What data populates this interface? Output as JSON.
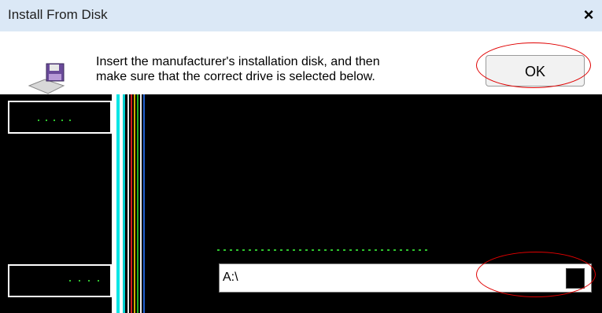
{
  "window": {
    "title": "Install From Disk",
    "close_label": "×"
  },
  "message": {
    "line1": "Insert the manufacturer's installation disk, and then",
    "line2": "make sure that the correct drive is selected below."
  },
  "buttons": {
    "ok_label": "OK"
  },
  "copy_from": {
    "value": "A:\\"
  },
  "icons": {
    "disk": "floppy-disk-icon",
    "dropdown": "dropdown-arrow-icon"
  },
  "colors": {
    "titlebar": "#dbe8f6",
    "annotation": "#e00000",
    "glitch": "#000000"
  }
}
